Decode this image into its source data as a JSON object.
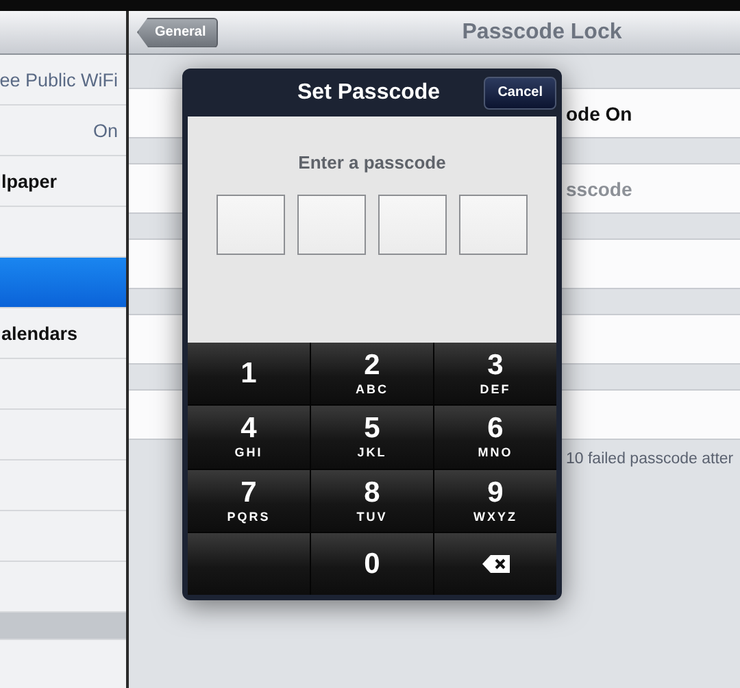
{
  "sidebar": {
    "items": [
      {
        "label": "ee Public WiFi",
        "kind": "value",
        "selected": false
      },
      {
        "label": "On",
        "kind": "value",
        "selected": false
      },
      {
        "label": "lpaper",
        "kind": "title",
        "selected": false
      },
      {
        "kind": "title",
        "selected": false
      },
      {
        "kind": "title",
        "selected": true
      },
      {
        "label": "alendars",
        "kind": "title",
        "selected": false
      },
      {
        "kind": "title",
        "selected": false
      },
      {
        "kind": "title",
        "selected": false
      },
      {
        "kind": "title",
        "selected": false
      },
      {
        "kind": "title",
        "selected": false
      },
      {
        "kind": "title",
        "selected": false
      },
      {
        "kind": "gap",
        "selected": false
      },
      {
        "kind": "title",
        "selected": false
      }
    ]
  },
  "nav": {
    "back": "General",
    "title": "Passcode Lock"
  },
  "settings": {
    "groups": [
      {
        "label": "ode On",
        "kind": "title"
      },
      {
        "label": "sscode",
        "kind": "dim"
      },
      {
        "kind": "title"
      },
      {
        "kind": "title"
      },
      {
        "kind": "title"
      }
    ],
    "footer": "10 failed passcode atter"
  },
  "dialog": {
    "title": "Set Passcode",
    "cancel": "Cancel",
    "prompt": "Enter a passcode",
    "digits": [
      {
        "filled": false
      },
      {
        "filled": false
      },
      {
        "filled": false
      },
      {
        "filled": false
      }
    ],
    "keys": [
      {
        "kind": "digit",
        "digit": "1"
      },
      {
        "kind": "digit",
        "digit": "2",
        "letters": "ABC"
      },
      {
        "kind": "digit",
        "digit": "3",
        "letters": "DEF"
      },
      {
        "kind": "digit",
        "digit": "4",
        "letters": "GHI"
      },
      {
        "kind": "digit",
        "digit": "5",
        "letters": "JKL"
      },
      {
        "kind": "digit",
        "digit": "6",
        "letters": "MNO"
      },
      {
        "kind": "digit",
        "digit": "7",
        "letters": "PQRS"
      },
      {
        "kind": "digit",
        "digit": "8",
        "letters": "TUV"
      },
      {
        "kind": "digit",
        "digit": "9",
        "letters": "WXYZ"
      },
      {
        "kind": "blank"
      },
      {
        "kind": "digit",
        "digit": "0"
      },
      {
        "kind": "delete"
      }
    ]
  }
}
